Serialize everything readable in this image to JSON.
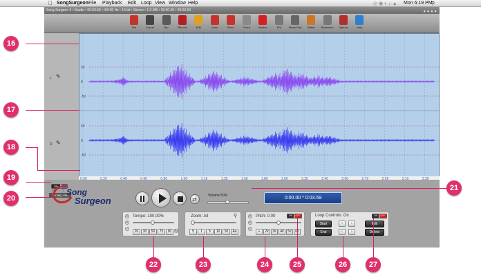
{
  "menu": {
    "app": "SongSurgeon",
    "items": [
      "File",
      "Playback",
      "Edit",
      "Loop",
      "View",
      "Window",
      "Help"
    ],
    "clock": "Mon 6:19 PM"
  },
  "window": {
    "title": "Song Surgeon 4 • Studio • 00:03.59 • 44100 Hz • 16 bit • Stereo • 1.5 MB • 00:00.00 • 00:03.59"
  },
  "toolbar": [
    {
      "label": "File",
      "icon": "file-icon",
      "color": "#c8322c"
    },
    {
      "label": "Export",
      "icon": "export-icon",
      "color": "#444444"
    },
    {
      "label": "Rip",
      "icon": "rip-disc-icon",
      "color": "#5a5a5a"
    },
    {
      "label": "Record",
      "icon": "record-icon",
      "color": "#b51f1f"
    },
    {
      "label": "Edit",
      "icon": "pencil-icon",
      "color": "#e0a020"
    },
    {
      "label": "Undo",
      "icon": "undo-icon",
      "color": "#c8322c"
    },
    {
      "label": "Redo",
      "icon": "redo-icon",
      "color": "#c8322c"
    },
    {
      "label": "Fixed",
      "icon": "pin-icon",
      "color": "#8a8a8a"
    },
    {
      "label": "Marker",
      "icon": "marker-icon",
      "color": "#d42020"
    },
    {
      "label": "EQ",
      "icon": "eq-icon",
      "color": "#777777"
    },
    {
      "label": "Music Pad",
      "icon": "music-pad-icon",
      "color": "#666666"
    },
    {
      "label": "Shifter",
      "icon": "shifter-icon",
      "color": "#c87828"
    },
    {
      "label": "Reduction",
      "icon": "reduction-icon",
      "color": "#777777"
    },
    {
      "label": "Options",
      "icon": "options-icon",
      "color": "#b03030"
    },
    {
      "label": "Help",
      "icon": "help-icon",
      "color": "#2f7fd0"
    }
  ],
  "channels": [
    "L",
    "R"
  ],
  "axis": {
    "upper": [
      "50",
      "0",
      "-50"
    ],
    "lower": [
      "50",
      "0",
      "-50"
    ],
    "times": [
      "0.00",
      "0.20",
      "0.40",
      "0.60",
      "0.80",
      "1.00",
      "1.19",
      "1.39",
      "1.59",
      "1.80",
      "2.00",
      "2.20",
      "2.40",
      "2.60",
      "2.79",
      "2.99",
      "3.19",
      "3.39"
    ]
  },
  "logo": {
    "line1": "Song",
    "line2": "Surgeon"
  },
  "mode": {
    "on": "ON",
    "pitch_letter": "P",
    "time_letter": "T"
  },
  "tuning": "Tuning: 440",
  "volume": {
    "label": "Volume:50%",
    "value": 50
  },
  "time_display": "0:00.00 * 0:03.59",
  "tempo": {
    "label": "Tempo: 100.00%",
    "buttons": [
      "20",
      "30",
      "50",
      "75",
      "90"
    ]
  },
  "zoom": {
    "label": "Zoom: All",
    "buttons": [
      "5",
      "1",
      "5",
      "10",
      "50",
      "Au"
    ]
  },
  "pitch": {
    "label": "Pitch: 0.00",
    "buttons": [
      "+",
      "2#",
      "3#",
      "4#",
      "5#",
      "6#"
    ],
    "off": "OFF",
    "toggle": "ON"
  },
  "loop": {
    "label": "Loop Controls: On",
    "start": "Start",
    "end": "End",
    "edit": "Edit",
    "delete": "Delete",
    "off": "OFF",
    "toggle": "ON"
  },
  "callouts": [
    "16",
    "17",
    "18",
    "19",
    "20",
    "21",
    "22",
    "23",
    "24",
    "25",
    "26",
    "27"
  ],
  "colors": {
    "callout": "#e0306a",
    "wave_upper": "#8a4df0",
    "wave_lower": "#3b3cf0",
    "wave_bg": "#b4cfe9"
  }
}
